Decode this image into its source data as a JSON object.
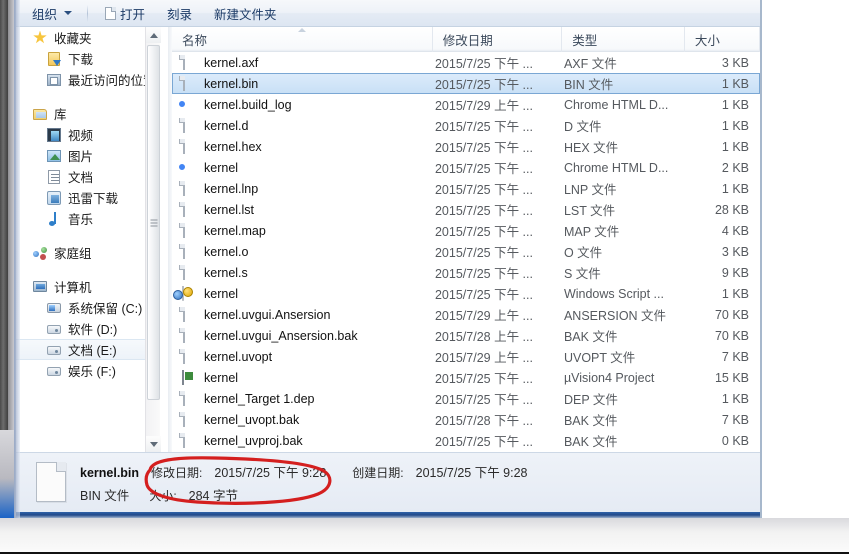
{
  "toolbar": {
    "organize": "组织",
    "open": "打开",
    "burn": "刻录",
    "new_folder": "新建文件夹"
  },
  "sidebar": {
    "groups": [
      {
        "header": {
          "label": "收藏夹",
          "icon": "star-icon"
        },
        "items": [
          {
            "label": "下载",
            "icon": "download-icon"
          },
          {
            "label": "最近访问的位置",
            "icon": "recent-places-icon"
          }
        ]
      },
      {
        "header": {
          "label": "库",
          "icon": "library-icon"
        },
        "items": [
          {
            "label": "视频",
            "icon": "video-icon"
          },
          {
            "label": "图片",
            "icon": "pictures-icon"
          },
          {
            "label": "文档",
            "icon": "documents-icon"
          },
          {
            "label": "迅雷下载",
            "icon": "xunlei-download-icon"
          },
          {
            "label": "音乐",
            "icon": "music-icon"
          }
        ]
      },
      {
        "header": {
          "label": "家庭组",
          "icon": "homegroup-icon"
        },
        "items": []
      },
      {
        "header": {
          "label": "计算机",
          "icon": "computer-icon"
        },
        "items": [
          {
            "label": "系统保留 (C:)",
            "icon": "system-drive-icon"
          },
          {
            "label": "软件 (D:)",
            "icon": "drive-icon"
          },
          {
            "label": "文档 (E:)",
            "icon": "drive-icon",
            "selected": true
          },
          {
            "label": "娱乐 (F:)",
            "icon": "drive-icon"
          }
        ]
      }
    ]
  },
  "filelist": {
    "columns": [
      {
        "label": "名称",
        "key": "name"
      },
      {
        "label": "修改日期",
        "key": "date"
      },
      {
        "label": "类型",
        "key": "type"
      },
      {
        "label": "大小",
        "key": "size"
      }
    ],
    "rows": [
      {
        "name": "kernel.axf",
        "date": "2015/7/25 下午 ...",
        "type": "AXF 文件",
        "size": "3 KB",
        "icon": "file-icon"
      },
      {
        "name": "kernel.bin",
        "date": "2015/7/25 下午 ...",
        "type": "BIN 文件",
        "size": "1 KB",
        "icon": "file-icon",
        "selected": true
      },
      {
        "name": "kernel.build_log",
        "date": "2015/7/29 上午 ...",
        "type": "Chrome HTML D...",
        "size": "1 KB",
        "icon": "chrome-icon"
      },
      {
        "name": "kernel.d",
        "date": "2015/7/25 下午 ...",
        "type": "D 文件",
        "size": "1 KB",
        "icon": "file-icon"
      },
      {
        "name": "kernel.hex",
        "date": "2015/7/25 下午 ...",
        "type": "HEX 文件",
        "size": "1 KB",
        "icon": "file-icon"
      },
      {
        "name": "kernel",
        "date": "2015/7/25 下午 ...",
        "type": "Chrome HTML D...",
        "size": "2 KB",
        "icon": "chrome-icon"
      },
      {
        "name": "kernel.lnp",
        "date": "2015/7/25 下午 ...",
        "type": "LNP 文件",
        "size": "1 KB",
        "icon": "file-icon"
      },
      {
        "name": "kernel.lst",
        "date": "2015/7/25 下午 ...",
        "type": "LST 文件",
        "size": "28 KB",
        "icon": "file-icon"
      },
      {
        "name": "kernel.map",
        "date": "2015/7/25 下午 ...",
        "type": "MAP 文件",
        "size": "4 KB",
        "icon": "file-icon"
      },
      {
        "name": "kernel.o",
        "date": "2015/7/25 下午 ...",
        "type": "O 文件",
        "size": "3 KB",
        "icon": "file-icon"
      },
      {
        "name": "kernel.s",
        "date": "2015/7/25 下午 ...",
        "type": "S 文件",
        "size": "9 KB",
        "icon": "file-icon"
      },
      {
        "name": "kernel",
        "date": "2015/7/25 下午 ...",
        "type": "Windows Script ...",
        "size": "1 KB",
        "icon": "script-icon"
      },
      {
        "name": "kernel.uvgui.Ansersion",
        "date": "2015/7/29 上午 ...",
        "type": "ANSERSION 文件",
        "size": "70 KB",
        "icon": "file-icon"
      },
      {
        "name": "kernel.uvgui_Ansersion.bak",
        "date": "2015/7/28 上午 ...",
        "type": "BAK 文件",
        "size": "70 KB",
        "icon": "file-icon"
      },
      {
        "name": "kernel.uvopt",
        "date": "2015/7/29 上午 ...",
        "type": "UVOPT 文件",
        "size": "7 KB",
        "icon": "file-icon"
      },
      {
        "name": "kernel",
        "date": "2015/7/25 下午 ...",
        "type": "µVision4 Project",
        "size": "15 KB",
        "icon": "uvision-icon"
      },
      {
        "name": "kernel_Target 1.dep",
        "date": "2015/7/25 下午 ...",
        "type": "DEP 文件",
        "size": "1 KB",
        "icon": "file-icon"
      },
      {
        "name": "kernel_uvopt.bak",
        "date": "2015/7/28 下午 ...",
        "type": "BAK 文件",
        "size": "7 KB",
        "icon": "file-icon"
      },
      {
        "name": "kernel_uvproj.bak",
        "date": "2015/7/25 下午 ...",
        "type": "BAK 文件",
        "size": "0 KB",
        "icon": "file-icon"
      }
    ]
  },
  "details": {
    "file_name": "kernel.bin",
    "file_type": "BIN 文件",
    "modified_label": "修改日期:",
    "modified_value": "2015/7/25 下午 9:28",
    "created_label": "创建日期:",
    "created_value": "2015/7/25 下午 9:28",
    "size_label": "大小:",
    "size_value": "284 字节"
  },
  "annotation": {
    "shape": "red-ellipse",
    "color": "#d41f1f",
    "encircles": "大小: 284 字节"
  },
  "colors": {
    "selection_fill": "#cfe3f7",
    "selection_border": "#7aa7d4",
    "toolbar_text": "#1b3a66",
    "annotation_red": "#d41f1f"
  }
}
